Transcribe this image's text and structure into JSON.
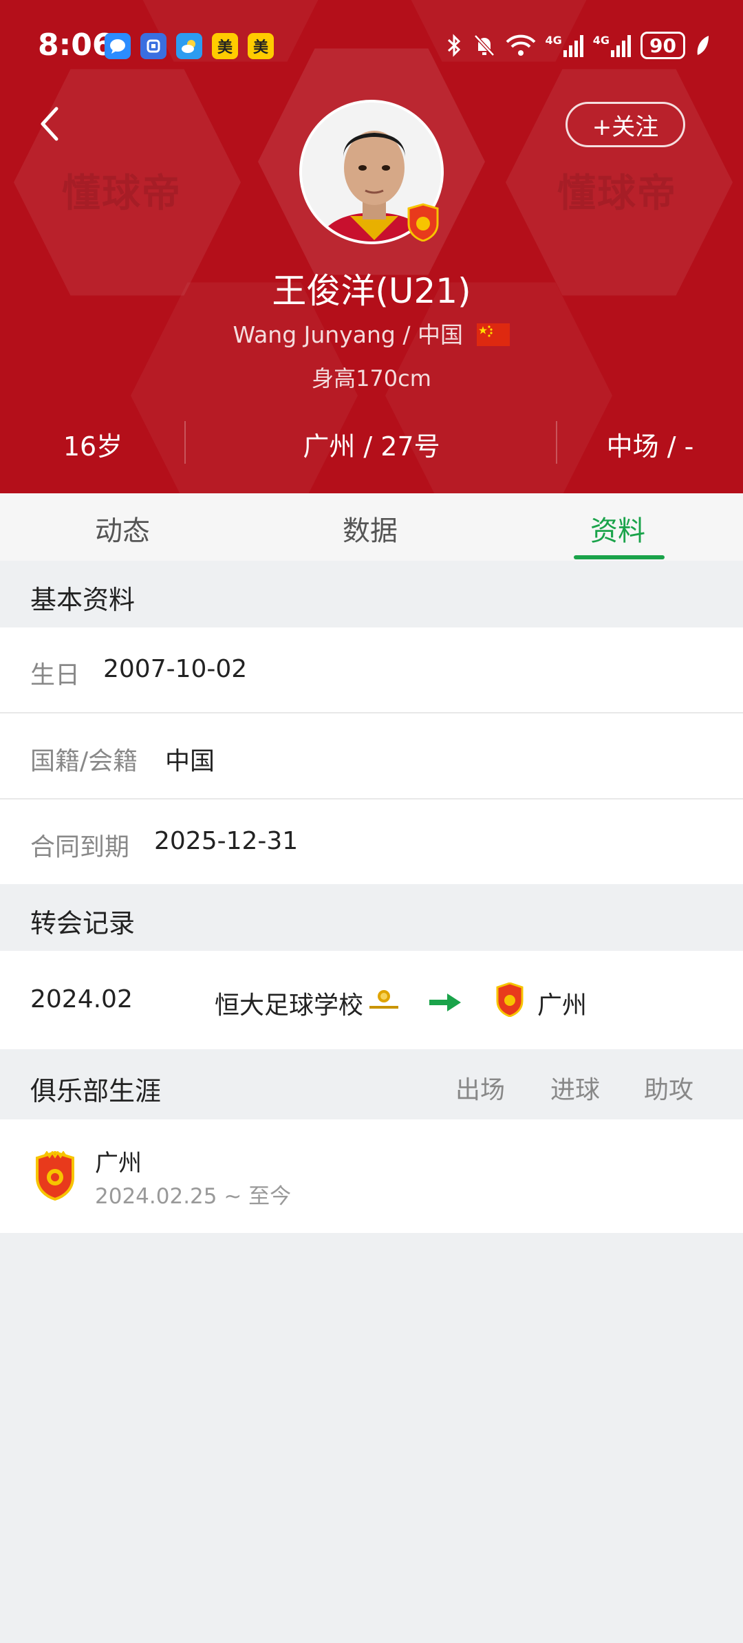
{
  "status_bar": {
    "time": "8:06",
    "battery": "90",
    "app_badges": [
      "美",
      "美"
    ]
  },
  "header": {
    "follow_label": "+关注",
    "watermark": "懂球帝",
    "player_name": "王俊洋(U21)",
    "english_name": "Wang Junyang",
    "nationality": "中国",
    "height": "身高170cm",
    "stats": {
      "age": "16岁",
      "club_number": "广州 / 27号",
      "position": "中场 / -"
    }
  },
  "tabs": [
    "动态",
    "数据",
    "资料"
  ],
  "active_tab": "资料",
  "basic_info": {
    "title": "基本资料",
    "rows": [
      {
        "label": "生日",
        "value": "2007-10-02"
      },
      {
        "label": "国籍/会籍",
        "value": "中国"
      },
      {
        "label": "合同到期",
        "value": "2025-12-31"
      }
    ]
  },
  "transfer": {
    "title": "转会记录",
    "date": "2024.02",
    "from_club": "恒大足球学校",
    "to_club": "广州"
  },
  "career": {
    "title": "俱乐部生涯",
    "columns": [
      "出场",
      "进球",
      "助攻"
    ],
    "club": "广州",
    "period": "2024.02.25 ~ 至今"
  },
  "colors": {
    "header_red": "#b40f1a",
    "accent_green": "#1aa34a"
  }
}
